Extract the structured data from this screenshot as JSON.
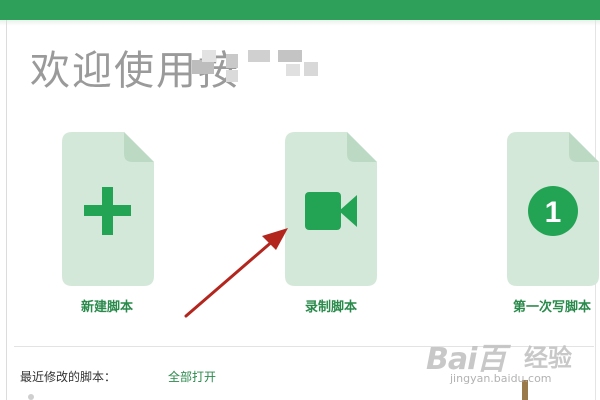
{
  "welcome": {
    "title": "欢迎使用按",
    "title_redacted": true
  },
  "cards": [
    {
      "label": "新建脚本",
      "icon": "plus-icon"
    },
    {
      "label": "录制脚本",
      "icon": "video-camera-icon"
    },
    {
      "label": "第一次写脚本",
      "icon": "number-one-icon",
      "badge": "1"
    }
  ],
  "recent": {
    "label": "最近修改的脚本：",
    "open_all": "全部打开"
  },
  "watermark": {
    "logo": "Bai百",
    "name": "经验",
    "domain": "jingyan.baidu.com"
  },
  "colors": {
    "accent": "#2ea05a",
    "card_bg": "#d4e8d9",
    "card_fold": "#bcd9c4",
    "icon_green": "#23a455",
    "label_green": "#2a8a4c",
    "arrow_red": "#b3261e",
    "welcome_gray": "#9a9a9a"
  }
}
